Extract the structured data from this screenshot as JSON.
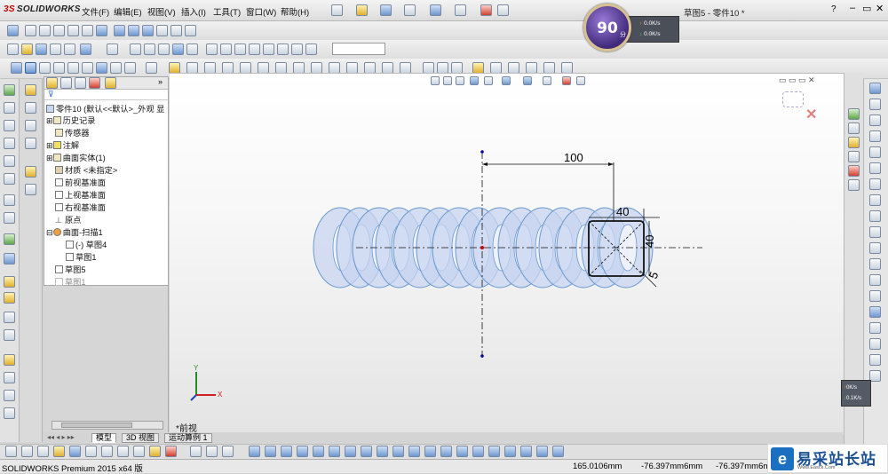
{
  "app": {
    "logo_ds": "3S",
    "logo_text": "SOLIDWORKS",
    "document_title": "草图5 - 零件10 *"
  },
  "menu": [
    {
      "label": "文件(F)"
    },
    {
      "label": "编辑(E)"
    },
    {
      "label": "视图(V)"
    },
    {
      "label": "插入(I)"
    },
    {
      "label": "工具(T)"
    },
    {
      "label": "窗口(W)"
    },
    {
      "label": "帮助(H)"
    }
  ],
  "speed_widget": {
    "value": "90",
    "unit": "分",
    "upload": "0.0K/s",
    "download": "0.0K/s"
  },
  "feature_tree": {
    "root": "零件10 (默认<<默认>_外观 显",
    "nodes": [
      {
        "label": "历史记录"
      },
      {
        "label": "传感器"
      },
      {
        "label": "注解"
      },
      {
        "label": "曲面实体(1)"
      },
      {
        "label": "材质 <未指定>"
      },
      {
        "label": "前视基准面"
      },
      {
        "label": "上视基准面"
      },
      {
        "label": "右视基准面"
      },
      {
        "label": "原点"
      },
      {
        "label": "曲面-扫描1"
      },
      {
        "label": "(-) 草图4"
      },
      {
        "label": "草图1"
      },
      {
        "label": "草图5"
      },
      {
        "label": "草图1"
      }
    ]
  },
  "viewport": {
    "view_label": "*前视",
    "dimensions": {
      "d100": "100",
      "d40_h": "40",
      "d40_v": "40",
      "d5": "5"
    },
    "axis_y": "Y",
    "axis_x": "X"
  },
  "bottom_tabs": [
    {
      "label": "模型"
    },
    {
      "label": "3D 视图"
    },
    {
      "label": "运动算例 1"
    }
  ],
  "status": {
    "product": "SOLIDWORKS Premium 2015 x64 版",
    "coord_x": "165.0106mm",
    "coord_y": "-76.397mm",
    "coord_y_suffix": "6mm",
    "coord_z": "-76.397mm",
    "coord_z_suffix": "6mm"
  },
  "net_panel": {
    "upload": "0K/s",
    "download": "0.1K/s"
  },
  "watermark": {
    "icon": "e",
    "text": "易采站长站",
    "sub": "Www.Easck.Com"
  },
  "colors": {
    "spring_fill": "#c8d4f0",
    "spring_stroke": "#6a9ad0",
    "sketch_line": "#000000",
    "accent_blue": "#1a6fc0"
  }
}
